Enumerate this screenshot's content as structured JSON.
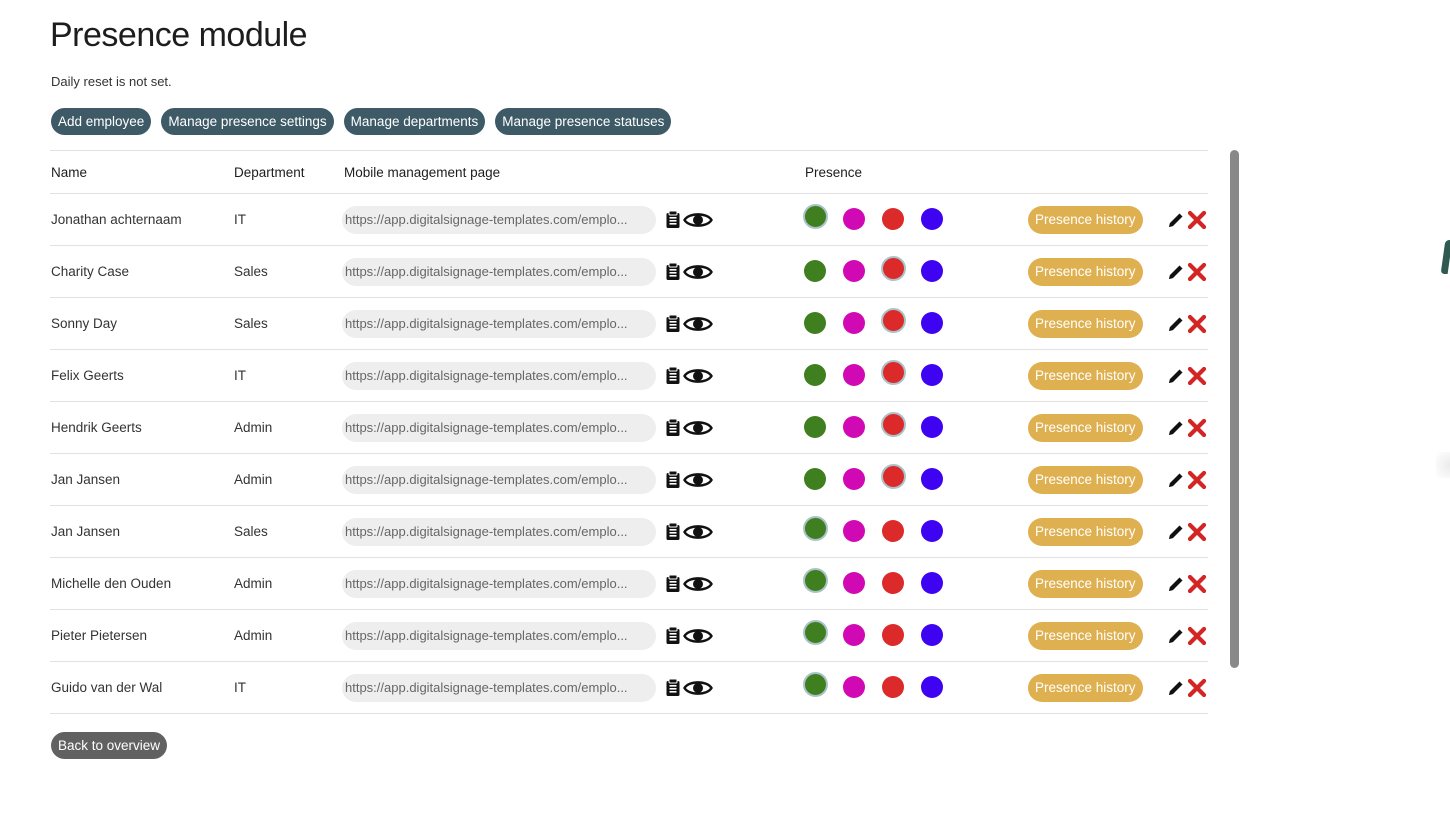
{
  "page": {
    "title": "Presence module",
    "subtitle": "Daily reset is not set."
  },
  "actions": {
    "add_employee": "Add employee",
    "manage_settings": "Manage presence settings",
    "manage_departments": "Manage departments",
    "manage_statuses": "Manage presence statuses",
    "back": "Back to overview"
  },
  "table": {
    "columns": {
      "name": "Name",
      "department": "Department",
      "mobile": "Mobile management page",
      "presence": "Presence"
    },
    "history_label": "Presence history",
    "status_colors": [
      "#3f7f1f",
      "#d109b5",
      "#dc2a2a",
      "#3e04f2"
    ],
    "rows": [
      {
        "name": "Jonathan achternaam",
        "department": "IT",
        "url": "https://app.digitalsignage-templates.com/emplo...",
        "active_status": 0
      },
      {
        "name": "Charity Case",
        "department": "Sales",
        "url": "https://app.digitalsignage-templates.com/emplo...",
        "active_status": 2
      },
      {
        "name": "Sonny  Day",
        "department": "Sales",
        "url": "https://app.digitalsignage-templates.com/emplo...",
        "active_status": 2
      },
      {
        "name": "Felix Geerts",
        "department": "IT",
        "url": "https://app.digitalsignage-templates.com/emplo...",
        "active_status": 2
      },
      {
        "name": "Hendrik Geerts",
        "department": "Admin",
        "url": "https://app.digitalsignage-templates.com/emplo...",
        "active_status": 2
      },
      {
        "name": "Jan Jansen",
        "department": "Admin",
        "url": "https://app.digitalsignage-templates.com/emplo...",
        "active_status": 2
      },
      {
        "name": "Jan Jansen",
        "department": "Sales",
        "url": "https://app.digitalsignage-templates.com/emplo...",
        "active_status": 0
      },
      {
        "name": "Michelle den Ouden",
        "department": "Admin",
        "url": "https://app.digitalsignage-templates.com/emplo...",
        "active_status": 0
      },
      {
        "name": "Pieter  Pietersen",
        "department": "Admin",
        "url": "https://app.digitalsignage-templates.com/emplo...",
        "active_status": 0
      },
      {
        "name": "Guido van der Wal",
        "department": "IT",
        "url": "https://app.digitalsignage-templates.com/emplo...",
        "active_status": 0
      }
    ]
  },
  "icons": {
    "copy": "clipboard-icon",
    "view": "eye-icon",
    "edit": "pencil-icon",
    "delete": "close-icon"
  }
}
